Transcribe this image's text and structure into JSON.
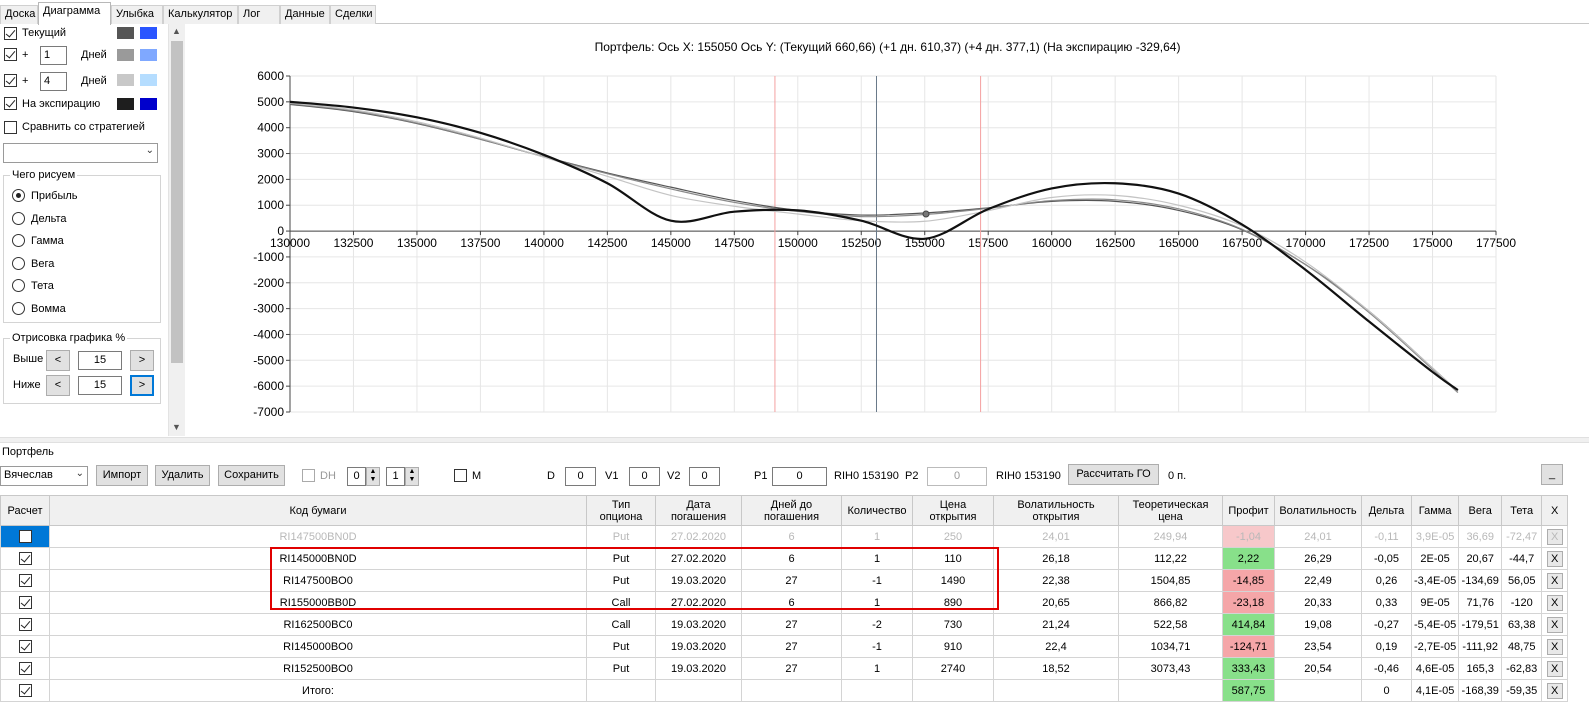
{
  "tabs": [
    "Доска",
    "Диаграмма",
    "Улыбка",
    "Калькулятор",
    "Лог",
    "Данные",
    "Сделки"
  ],
  "active_tab": "Диаграмма",
  "left_panel": {
    "current_label": "Текущий",
    "plus": "+",
    "days_label": "Дней",
    "row1_days": "1",
    "row2_days": "4",
    "expiration_label": "На экспирацию",
    "compare_label": "Сравнить со стратегией",
    "draw_what_title": "Чего рисуем",
    "radios": [
      "Прибыль",
      "Дельта",
      "Гамма",
      "Вега",
      "Тета",
      "Вомма"
    ],
    "selected_radio": "Прибыль",
    "render_title": "Отрисовка графика %",
    "above_label": "Выше",
    "below_label": "Ниже",
    "above_value": "15",
    "below_value": "15",
    "left_arrow": "<",
    "right_arrow": ">",
    "swatch_colors": {
      "current": [
        "#555555",
        "#2a55ff"
      ],
      "plus1": [
        "#9a9a9a",
        "#7fa8ff"
      ],
      "plus4": [
        "#c8c8c8",
        "#b5ddff"
      ],
      "expiration": [
        "#1e1e1e",
        "#0000cc"
      ]
    }
  },
  "chart": {
    "title": "Портфель: Ось X:  155050 Ось Y:  (Текущий 660,66)  (+1 дн. 610,37)  (+4 дн. 377,1)  (На экспирацию -329,64)"
  },
  "chart_data": {
    "type": "line",
    "title": "Портфель: Ось X:  155050 Ось Y:  (Текущий 660,66)  (+1 дн. 610,37)  (+4 дн. 377,1)  (На экспирацию -329,64)",
    "xlabel": "",
    "ylabel": "",
    "xlim": [
      130000,
      177500
    ],
    "ylim": [
      -7000,
      6000
    ],
    "x_ticks": [
      130000,
      132500,
      135000,
      137500,
      140000,
      142500,
      145000,
      147500,
      150000,
      152500,
      155000,
      157500,
      160000,
      162500,
      165000,
      167500,
      170000,
      172500,
      175000,
      177500
    ],
    "y_ticks": [
      6000,
      5000,
      4000,
      3000,
      2000,
      1000,
      0,
      -1000,
      -2000,
      -3000,
      -4000,
      -5000,
      -6000,
      -7000
    ],
    "grid": true,
    "vertical_markers": [
      {
        "x": 149100,
        "color": "#f4a0a0"
      },
      {
        "x": 153100,
        "color": "#6a7a8a"
      },
      {
        "x": 157200,
        "color": "#f4a0a0"
      }
    ],
    "cursor_point": {
      "x": 155050,
      "y": 660.66
    },
    "series": [
      {
        "name": "Текущий",
        "color": "#555555",
        "width": 1.2,
        "x": [
          130000,
          132500,
          135000,
          137500,
          140000,
          142500,
          145000,
          147500,
          150000,
          152500,
          155000,
          157500,
          160000,
          162500,
          165000,
          167500,
          170000,
          172500,
          175000,
          176000
        ],
        "y": [
          4900,
          4620,
          4160,
          3550,
          2880,
          2250,
          1700,
          1180,
          800,
          620,
          700,
          900,
          1150,
          1150,
          800,
          50,
          -1300,
          -3100,
          -5300,
          -6200
        ]
      },
      {
        "name": "+1 дн.",
        "color": "#8a8a8a",
        "width": 1.2,
        "x": [
          130000,
          132500,
          135000,
          137500,
          140000,
          142500,
          145000,
          147500,
          150000,
          152500,
          155000,
          157500,
          160000,
          162500,
          165000,
          167500,
          170000,
          172500,
          175000,
          176000
        ],
        "y": [
          4930,
          4650,
          4180,
          3560,
          2870,
          2220,
          1630,
          1110,
          760,
          560,
          640,
          880,
          1180,
          1210,
          860,
          70,
          -1300,
          -3150,
          -5350,
          -6250
        ]
      },
      {
        "name": "+4 дн.",
        "color": "#c4c4c4",
        "width": 1.2,
        "x": [
          130000,
          132500,
          135000,
          137500,
          140000,
          142500,
          145000,
          147500,
          150000,
          152500,
          155000,
          157500,
          160000,
          162500,
          165000,
          167500,
          170000,
          172500,
          175000,
          176000
        ],
        "y": [
          4960,
          4690,
          4230,
          3600,
          2860,
          2120,
          1380,
          960,
          660,
          400,
          380,
          790,
          1300,
          1380,
          1000,
          200,
          -1200,
          -3100,
          -5300,
          -6200
        ]
      },
      {
        "name": "На экспирацию",
        "color": "#111111",
        "width": 2.2,
        "x": [
          130000,
          132500,
          135000,
          137500,
          140000,
          142500,
          145000,
          147500,
          150000,
          152500,
          155000,
          157500,
          160000,
          162500,
          165000,
          167500,
          170000,
          172500,
          175000,
          176000
        ],
        "y": [
          5000,
          4780,
          4400,
          3800,
          2950,
          1850,
          400,
          750,
          800,
          400,
          -300,
          850,
          1650,
          1850,
          1450,
          250,
          -1500,
          -3500,
          -5450,
          -6150
        ]
      }
    ]
  },
  "portfolio": {
    "title": "Портфель",
    "owner": "Вячеслав",
    "import_label": "Импорт",
    "delete_label": "Удалить",
    "save_label": "Сохранить",
    "dh_label": "DH",
    "dh_value1": "0",
    "dh_value2": "1",
    "m_label": "M",
    "d_label": "D",
    "d_value": "0",
    "v1_label": "V1",
    "v1_value": "0",
    "v2_label": "V2",
    "v2_value": "0",
    "p1_label": "P1",
    "p1_value": "0",
    "p1_ticker": "RIH0 153190",
    "p2_label": "P2",
    "p2_value": "0",
    "p2_ticker": "RIH0 153190",
    "calc_go_label": "Рассчитать ГО",
    "go_value": "0 п.",
    "minimize_label": "_"
  },
  "table": {
    "headers": [
      "Расчет",
      "Код бумаги",
      "Тип опциона",
      "Дата погашения",
      "Дней до погашения",
      "Количество",
      "Цена открытия",
      "Волатильность открытия",
      "Теоретическая цена",
      "Профит",
      "Волатильность",
      "Дельта",
      "Гамма",
      "Вега",
      "Тета",
      "X"
    ],
    "rows": [
      {
        "checked": false,
        "faded": true,
        "code": "RI147500BN0D",
        "type": "Put",
        "date": "27.02.2020",
        "days": "6",
        "qty": "1",
        "open_price": "250",
        "open_vol": "24,01",
        "theo": "249,94",
        "profit": "-1,04",
        "profit_state": "faded-neg",
        "vol": "24,01",
        "delta": "-0,11",
        "gamma": "3,9E-05",
        "vega": "36,69",
        "theta": "-72,47",
        "x": "X"
      },
      {
        "checked": true,
        "faded": false,
        "code": "RI145000BN0D",
        "type": "Put",
        "date": "27.02.2020",
        "days": "6",
        "qty": "1",
        "open_price": "110",
        "open_vol": "26,18",
        "theo": "112,22",
        "profit": "2,22",
        "profit_state": "pos",
        "vol": "26,29",
        "delta": "-0,05",
        "gamma": "2E-05",
        "vega": "20,67",
        "theta": "-44,7",
        "x": "X"
      },
      {
        "checked": true,
        "faded": false,
        "code": "RI147500BO0",
        "type": "Put",
        "date": "19.03.2020",
        "days": "27",
        "qty": "-1",
        "open_price": "1490",
        "open_vol": "22,38",
        "theo": "1504,85",
        "profit": "-14,85",
        "profit_state": "neg",
        "vol": "22,49",
        "delta": "0,26",
        "gamma": "-3,4E-05",
        "vega": "-134,69",
        "theta": "56,05",
        "x": "X"
      },
      {
        "checked": true,
        "faded": false,
        "code": "RI155000BB0D",
        "type": "Call",
        "date": "27.02.2020",
        "days": "6",
        "qty": "1",
        "open_price": "890",
        "open_vol": "20,65",
        "theo": "866,82",
        "profit": "-23,18",
        "profit_state": "neg",
        "vol": "20,33",
        "delta": "0,33",
        "gamma": "9E-05",
        "vega": "71,76",
        "theta": "-120",
        "x": "X"
      },
      {
        "checked": true,
        "faded": false,
        "code": "RI162500BC0",
        "type": "Call",
        "date": "19.03.2020",
        "days": "27",
        "qty": "-2",
        "open_price": "730",
        "open_vol": "21,24",
        "theo": "522,58",
        "profit": "414,84",
        "profit_state": "pos",
        "vol": "19,08",
        "delta": "-0,27",
        "gamma": "-5,4E-05",
        "vega": "-179,51",
        "theta": "63,38",
        "x": "X"
      },
      {
        "checked": true,
        "faded": false,
        "code": "RI145000BO0",
        "type": "Put",
        "date": "19.03.2020",
        "days": "27",
        "qty": "-1",
        "open_price": "910",
        "open_vol": "22,4",
        "theo": "1034,71",
        "profit": "-124,71",
        "profit_state": "neg",
        "vol": "23,54",
        "delta": "0,19",
        "gamma": "-2,7E-05",
        "vega": "-111,92",
        "theta": "48,75",
        "x": "X"
      },
      {
        "checked": true,
        "faded": false,
        "code": "RI152500BO0",
        "type": "Put",
        "date": "19.03.2020",
        "days": "27",
        "qty": "1",
        "open_price": "2740",
        "open_vol": "18,52",
        "theo": "3073,43",
        "profit": "333,43",
        "profit_state": "pos",
        "vol": "20,54",
        "delta": "-0,46",
        "gamma": "4,6E-05",
        "vega": "165,3",
        "theta": "-62,83",
        "x": "X"
      }
    ],
    "total": {
      "checked": true,
      "code": "Итого:",
      "profit": "587,75",
      "delta": "0",
      "gamma": "4,1E-05",
      "vega": "-168,39",
      "theta": "-59,35",
      "x": "X"
    }
  }
}
